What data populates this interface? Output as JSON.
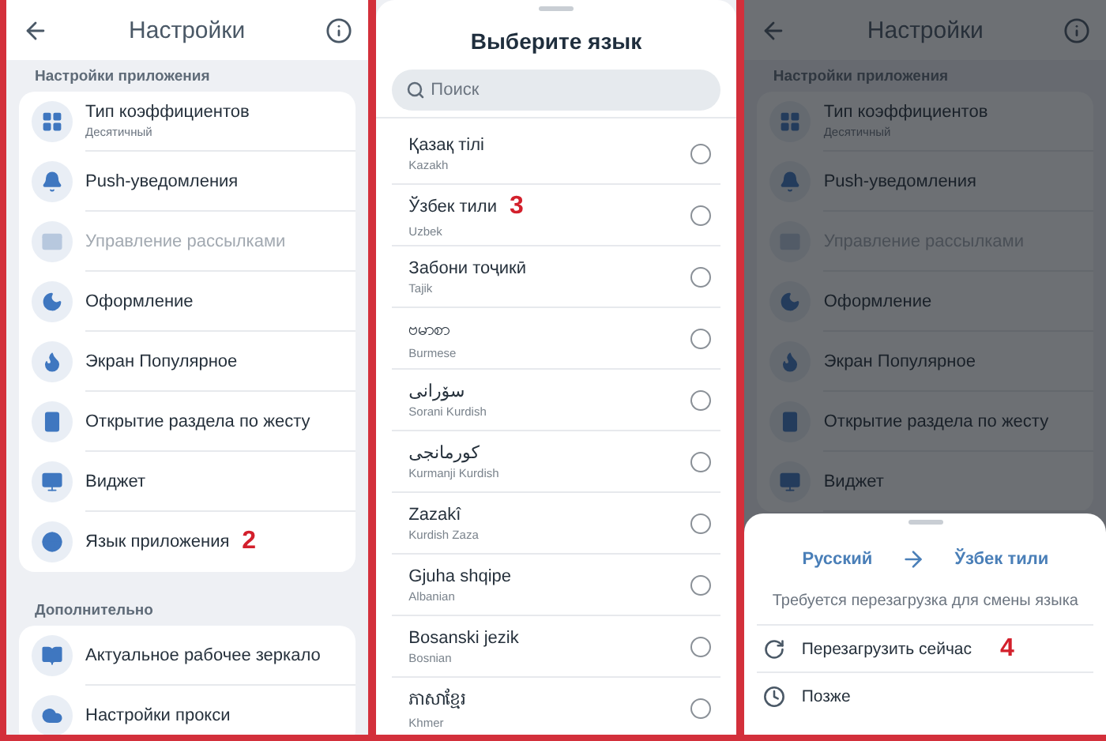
{
  "settings_screen": {
    "title": "Настройки",
    "sections": [
      {
        "title": "Настройки приложения",
        "items": [
          {
            "label": "Тип коэффициентов",
            "subtitle": "Десятичный",
            "disabled": false
          },
          {
            "label": "Push-уведомления",
            "disabled": false
          },
          {
            "label": "Управление рассылками",
            "disabled": true
          },
          {
            "label": "Оформление",
            "disabled": false
          },
          {
            "label": "Экран Популярное",
            "disabled": false
          },
          {
            "label": "Открытие раздела по жесту",
            "disabled": false
          },
          {
            "label": "Виджет",
            "disabled": false
          },
          {
            "label": "Язык приложения",
            "disabled": false,
            "step": "2"
          }
        ]
      },
      {
        "title": "Дополнительно",
        "items": [
          {
            "label": "Актуальное рабочее зеркало",
            "disabled": false
          },
          {
            "label": "Настройки прокси",
            "disabled": false
          }
        ]
      }
    ]
  },
  "language_sheet": {
    "title": "Выберите язык",
    "search": {
      "placeholder": "Поиск"
    },
    "languages": [
      {
        "name": "Қазақ тілі",
        "english": "Kazakh",
        "selected": false
      },
      {
        "name": "Ўзбек тили",
        "english": "Uzbek",
        "selected": false,
        "step": "3"
      },
      {
        "name": "Забони тоҷикӣ",
        "english": "Tajik",
        "selected": false
      },
      {
        "name": "ဗမာစာ",
        "english": "Burmese",
        "selected": false
      },
      {
        "name": "سۆرانی",
        "english": "Sorani Kurdish",
        "selected": false
      },
      {
        "name": "کورمانجی",
        "english": "Kurmanji Kurdish",
        "selected": false
      },
      {
        "name": "Zazakî",
        "english": "Kurdish Zaza",
        "selected": false
      },
      {
        "name": "Gjuha shqipe",
        "english": "Albanian",
        "selected": false
      },
      {
        "name": "Bosanski jezik",
        "english": "Bosnian",
        "selected": false
      },
      {
        "name": "ភាសាខ្មែរ",
        "english": "Khmer",
        "selected": false
      }
    ]
  },
  "restart_screen": {
    "background": {
      "title": "Настройки",
      "section_title": "Настройки приложения",
      "items": [
        {
          "label": "Тип коэффициентов",
          "subtitle": "Десятичный",
          "disabled": false
        },
        {
          "label": "Push-уведомления",
          "disabled": false
        },
        {
          "label": "Управление рассылками",
          "disabled": true
        },
        {
          "label": "Оформление",
          "disabled": false
        },
        {
          "label": "Экран Популярное",
          "disabled": false
        },
        {
          "label": "Открытие раздела по жесту",
          "disabled": false
        },
        {
          "label": "Виджет",
          "disabled": false
        }
      ]
    },
    "sheet": {
      "from": "Русский",
      "to": "Ўзбек тили",
      "message": "Требуется перезагрузка для смены языка",
      "actions": [
        {
          "kind": "restart",
          "label": "Перезагрузить сейчас",
          "step": "4"
        },
        {
          "kind": "later",
          "label": "Позже"
        }
      ]
    }
  }
}
